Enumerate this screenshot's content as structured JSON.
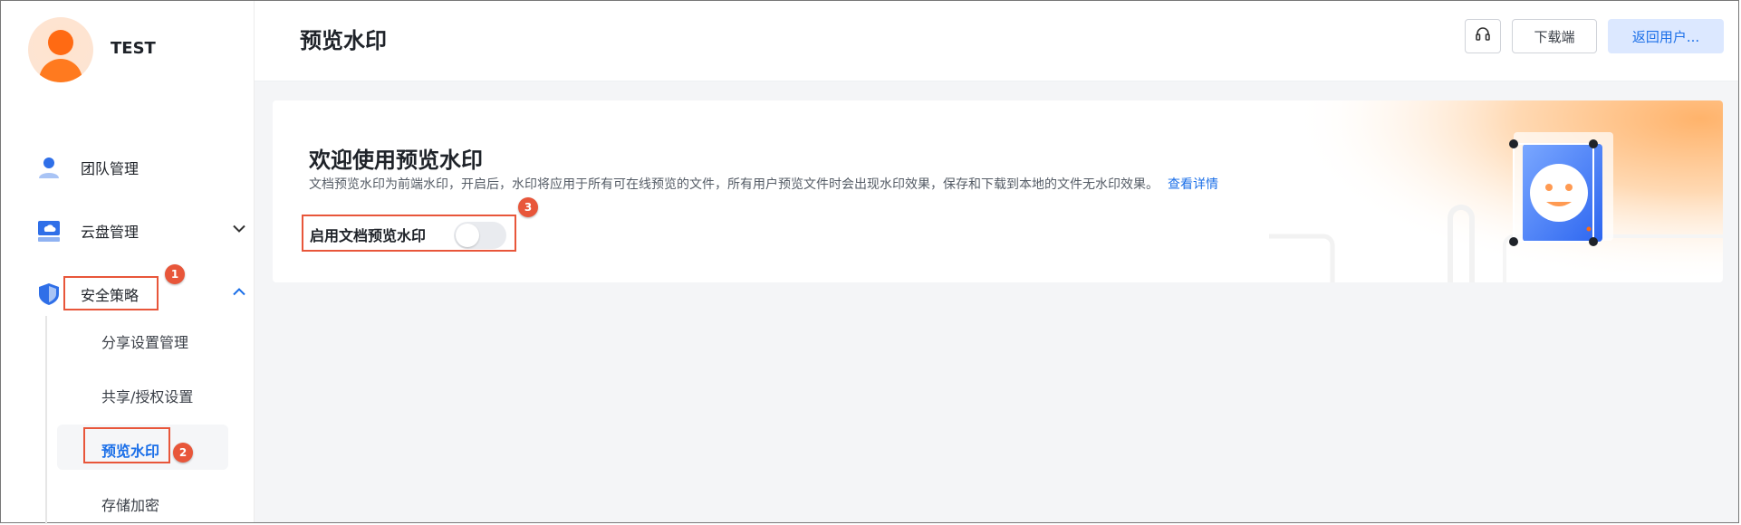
{
  "user": {
    "name": "TEST"
  },
  "sidebar": {
    "items": [
      {
        "label": "团队管理",
        "icon": "team-icon"
      },
      {
        "label": "云盘管理",
        "icon": "cloud-drive-icon",
        "chevron": "down"
      },
      {
        "label": "安全策略",
        "icon": "shield-icon",
        "chevron": "up",
        "expanded": true
      }
    ],
    "security_subitems": [
      {
        "label": "分享设置管理"
      },
      {
        "label": "共享/授权设置"
      },
      {
        "label": "预览水印",
        "active": true
      },
      {
        "label": "存储加密"
      }
    ]
  },
  "header": {
    "title": "预览水印",
    "support_icon": "headset-icon",
    "download_label": "下载端",
    "return_label": "返回用户..."
  },
  "card": {
    "title": "欢迎使用预览水印",
    "description": "文档预览水印为前端水印，开启后，水印将应用于所有可在线预览的文件，所有用户预览文件时会出现水印效果，保存和下载到本地的文件无水印效果。",
    "link": "查看详情",
    "toggle_label": "启用文档预览水印",
    "toggle_on": false
  },
  "annotations": [
    "1",
    "2",
    "3"
  ],
  "colors": {
    "accent": "#1b6fe8",
    "brand_orange": "#ff6a13",
    "annotation": "#e8563a"
  }
}
